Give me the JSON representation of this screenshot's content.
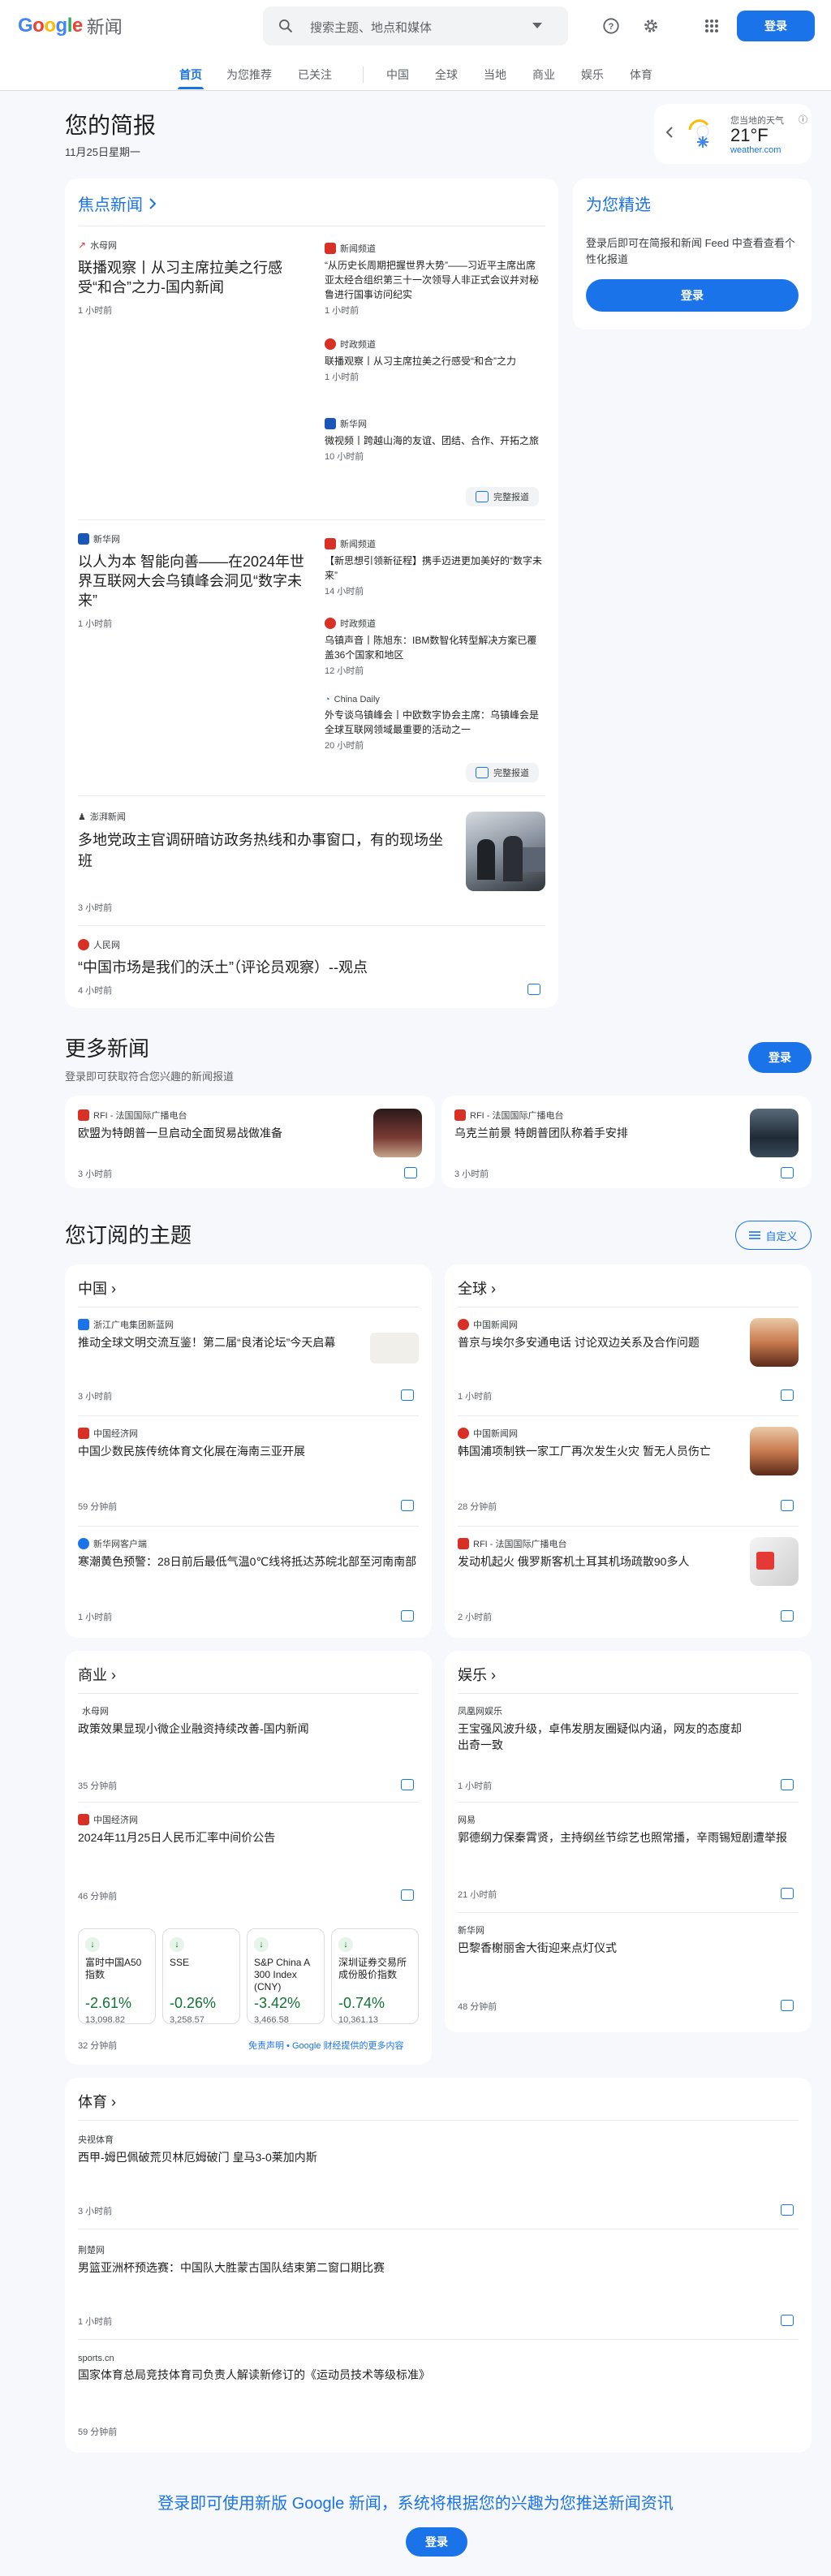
{
  "header": {
    "logo_google": "Google",
    "logo_news": "新闻",
    "search_placeholder": "搜索主题、地点和媒体",
    "signin": "登录"
  },
  "tabs": [
    "首页",
    "为您推荐",
    "已关注",
    "中国",
    "全球",
    "当地",
    "商业",
    "娱乐",
    "体育"
  ],
  "briefing": {
    "title": "您的简报",
    "date": "11月25日星期一"
  },
  "weather": {
    "label": "您当地的天气",
    "temp": "21°F",
    "source": "weather.com"
  },
  "top": {
    "title": "焦点新闻",
    "s1": {
      "src": "水母网",
      "title": "联播观察丨从习主席拉美之行感受“和合”之力-国内新闻",
      "time": "1 小时前",
      "rel": [
        {
          "src": "新闻频道",
          "title": "“从历史长周期把握世界大势”——习近平主席出席亚太经合组织第三十一次领导人非正式会议并对秘鲁进行国事访问纪实",
          "time": "1 小时前"
        },
        {
          "src": "时政频道",
          "title": "联播观察丨从习主席拉美之行感受“和合”之力",
          "time": "1 小时前"
        },
        {
          "src": "新华网",
          "title": "微视频丨跨越山海的友谊、团结、合作、开拓之旅",
          "time": "10 小时前"
        }
      ]
    },
    "s2": {
      "src": "新华网",
      "title": "以人为本 智能向善——在2024年世界互联网大会乌镇峰会洞见“数字未来”",
      "time": "1 小时前",
      "rel": [
        {
          "src": "新闻频道",
          "title": "【新思想引领新征程】携手迈进更加美好的“数字未来”",
          "time": "14 小时前"
        },
        {
          "src": "时政频道",
          "title": "乌镇声音丨陈旭东：IBM数智化转型解决方案已覆盖36个国家和地区",
          "time": "12 小时前"
        },
        {
          "src": "China Daily",
          "title": "外专谈乌镇峰会丨中欧数字协会主席：乌镇峰会是全球互联网领域最重要的活动之一",
          "time": "20 小时前"
        }
      ]
    },
    "full": "完整报道",
    "s3": {
      "src": "澎湃新闻",
      "title": "多地党政主官调研暗访政务热线和办事窗口，有的现场坐班",
      "time": "3 小时前"
    },
    "s4": {
      "src": "人民网",
      "title": "“中国市场是我们的沃土”（评论员观察）--观点",
      "time": "4 小时前"
    }
  },
  "picks": {
    "title": "为您精选",
    "desc": "登录后即可在简报和新闻 Feed 中查看查看个性化报道",
    "btn": "登录"
  },
  "more": {
    "title": "更多新闻",
    "sub": "登录即可获取符合您兴趣的新闻报道",
    "btn": "登录",
    "items": [
      {
        "src": "RFI - 法国国际广播电台",
        "title": "欧盟为特朗普一旦启动全面贸易战做准备",
        "time": "3 小时前"
      },
      {
        "src": "RFI - 法国国际广播电台",
        "title": "乌克兰前景 特朗普团队称着手安排",
        "time": "3 小时前"
      }
    ]
  },
  "topics": {
    "title": "您订阅的主题",
    "customize": "自定义",
    "china": {
      "title": "中国",
      "items": [
        {
          "src": "浙江广电集团新蓝网",
          "title": "推动全球文明交流互鉴！第二届“良渚论坛”今天启幕",
          "time": "3 小时前"
        },
        {
          "src": "中国经济网",
          "title": "中国少数民族传统体育文化展在海南三亚开展",
          "time": "59 分钟前"
        },
        {
          "src": "新华网客户端",
          "title": "寒潮黄色预警：28日前后最低气温0℃线将抵达苏皖北部至河南南部",
          "time": "1 小时前"
        }
      ]
    },
    "world": {
      "title": "全球",
      "items": [
        {
          "src": "中国新闻网",
          "title": "普京与埃尔多安通电话 讨论双边关系及合作问题",
          "time": "1 小时前"
        },
        {
          "src": "中国新闻网",
          "title": "韩国浦项制铁一家工厂再次发生火灾 暂无人员伤亡",
          "time": "28 分钟前"
        },
        {
          "src": "RFI - 法国国际广播电台",
          "title": "发动机起火 俄罗斯客机土耳其机场疏散90多人",
          "time": "2 小时前"
        }
      ]
    },
    "biz": {
      "title": "商业",
      "items": [
        {
          "src": "水母网",
          "title": "政策效果显现小微企业融资持续改善-国内新闻",
          "time": "35 分钟前"
        },
        {
          "src": "中国经济网",
          "title": "2024年11月25日人民币汇率中间价公告",
          "time": "46 分钟前"
        }
      ],
      "stocks": [
        {
          "name": "富时中国A50指数",
          "pct": "-2.61%",
          "val": "13,098.82"
        },
        {
          "name": "SSE",
          "pct": "-0.26%",
          "val": "3,258.57"
        },
        {
          "name": "S&P China A 300 Index (CNY)",
          "pct": "-3.42%",
          "val": "3,466.58"
        },
        {
          "name": "深圳证券交易所成份股价指数",
          "pct": "-0.74%",
          "val": "10,361.13"
        }
      ],
      "stock_time": "32 分钟前",
      "disclaimer": "免责声明 • Google 财经提供的更多内容"
    },
    "ent": {
      "title": "娱乐",
      "items": [
        {
          "src": "凤凰网娱乐",
          "title": "王宝强风波升级，卓伟发朋友圈疑似内涵，网友的态度却出奇一致",
          "time": "1 小时前"
        },
        {
          "src": "网易",
          "title": "郭德纲力保秦霄贤，主持纲丝节综艺也照常播，辛雨锡短剧遭举报",
          "time": "21 小时前"
        },
        {
          "src": "新华网",
          "title": "巴黎香榭丽舍大街迎来点灯仪式",
          "time": "48 分钟前"
        }
      ]
    },
    "sports": {
      "title": "体育",
      "items": [
        {
          "src": "央视体育",
          "title": "西甲-姆巴佩破荒贝林厄姆破门 皇马3-0莱加内斯",
          "time": "3 小时前"
        },
        {
          "src": "荆楚网",
          "title": "男篮亚洲杯预选赛：中国队大胜蒙古国队结束第二窗口期比赛",
          "time": "1 小时前"
        },
        {
          "src": "sports.cn",
          "title": "国家体育总局竞技体育司负责人解读新修订的《运动员技术等级标准》",
          "time": "59 分钟前"
        }
      ]
    }
  },
  "footer": {
    "cta": "登录即可使用新版 Google 新闻，系统将根据您的兴趣为您推送新闻资讯",
    "btn": "登录"
  },
  "colors": {
    "accent": "#1a73e8",
    "down": "#137333"
  }
}
